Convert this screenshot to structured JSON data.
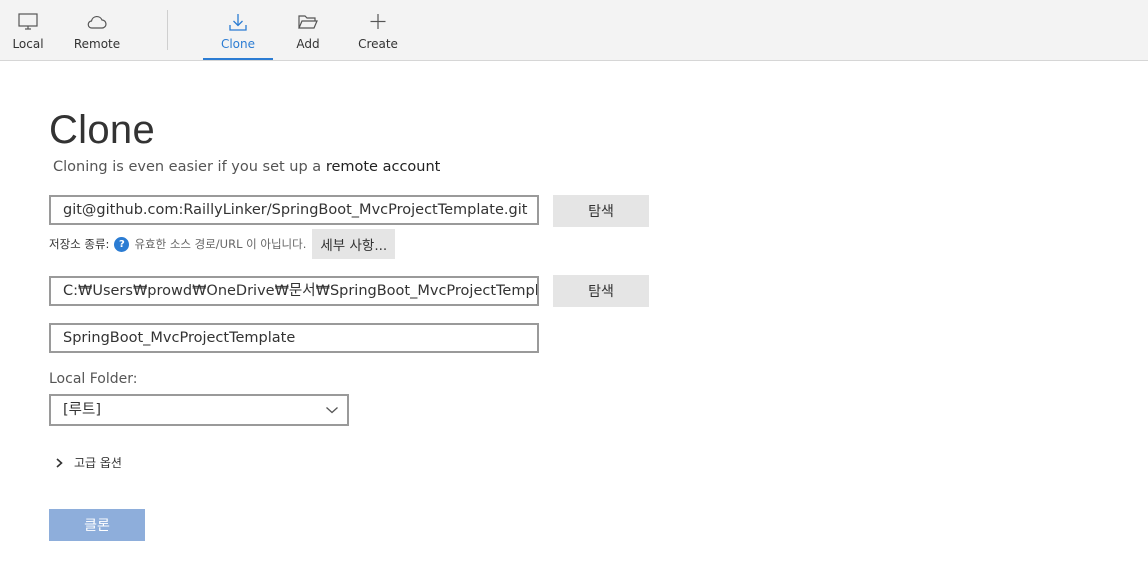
{
  "toolbar": {
    "items": [
      {
        "label": "Local",
        "icon": "monitor-icon"
      },
      {
        "label": "Remote",
        "icon": "cloud-icon"
      },
      {
        "label": "Clone",
        "icon": "download-icon"
      },
      {
        "label": "Add",
        "icon": "folder-open-icon"
      },
      {
        "label": "Create",
        "icon": "plus-icon"
      }
    ],
    "active": "Clone",
    "accent_color": "#2b7cd3"
  },
  "form": {
    "title": "Clone",
    "subtitle_text": "Cloning is even easier if you set up a",
    "subtitle_link": "remote account",
    "source_url": "git@github.com:RaillyLinker/SpringBoot_MvcProjectTemplate.git",
    "browse_label_1": "탐색",
    "repo_type_label": "저장소 종류:",
    "repo_type_help_icon": "question-circle-icon",
    "repo_type_help_glyph": "?",
    "repo_type_status": "유효한 소스 경로/URL 이 아닙니다.",
    "details_label": "세부 사항...",
    "destination_path": "C:₩Users₩prowd₩OneDrive₩문서₩SpringBoot_MvcProjectTemplate",
    "browse_label_2": "탐색",
    "name": "SpringBoot_MvcProjectTemplate",
    "local_folder_label": "Local Folder:",
    "local_folder_value": "[루트]",
    "advanced_label": "고급 옵션",
    "clone_button_label": "클론",
    "clone_button_color": "#8eaedb"
  }
}
